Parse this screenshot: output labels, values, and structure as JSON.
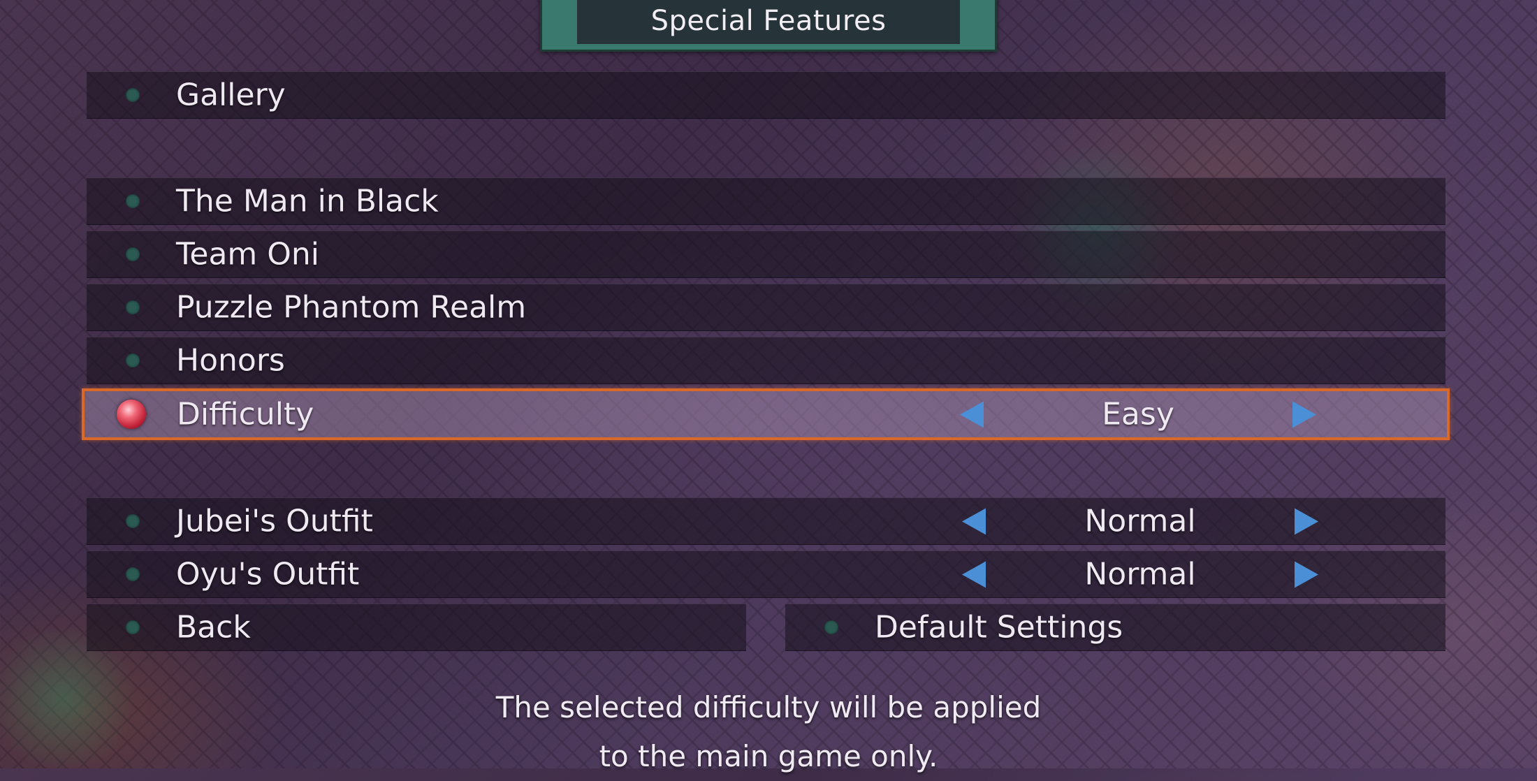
{
  "header": {
    "title": "Special Features"
  },
  "menu": {
    "gallery": "Gallery",
    "man_in_black": "The Man in Black",
    "team_oni": "Team Oni",
    "puzzle_phantom_realm": "Puzzle Phantom Realm",
    "honors": "Honors",
    "difficulty": {
      "label": "Difficulty",
      "value": "Easy"
    },
    "jubei_outfit": {
      "label": "Jubei's Outfit",
      "value": "Normal"
    },
    "oyu_outfit": {
      "label": "Oyu's Outfit",
      "value": "Normal"
    },
    "back": "Back",
    "default_settings": "Default Settings"
  },
  "description": {
    "line1": "The selected difficulty will be applied",
    "line2": "to the main game only."
  },
  "colors": {
    "highlight_border": "#d9692a",
    "arrow": "#4b8fd6",
    "title_plate": "#3a7a6e",
    "selected_dot": "#c22238"
  },
  "icons": [
    "selection-orb-icon",
    "bullet-dot-icon",
    "arrow-left-icon",
    "arrow-right-icon"
  ]
}
